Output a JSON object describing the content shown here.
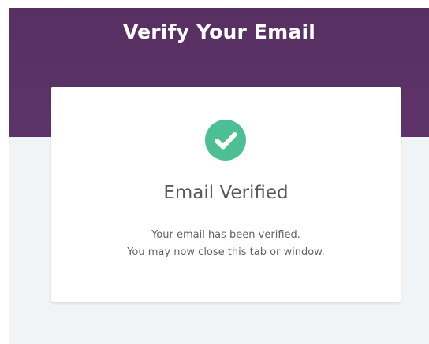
{
  "header": {
    "title": "Verify Your Email"
  },
  "card": {
    "icon": "check-circle-icon",
    "title": "Email Verified",
    "message_line1": "Your email has been verified.",
    "message_line2": "You may now close this tab or window."
  },
  "colors": {
    "banner": "#5a3166",
    "success": "#4cbf94",
    "background": "#f1f4f6",
    "card": "#ffffff",
    "title_text": "#555b63"
  }
}
